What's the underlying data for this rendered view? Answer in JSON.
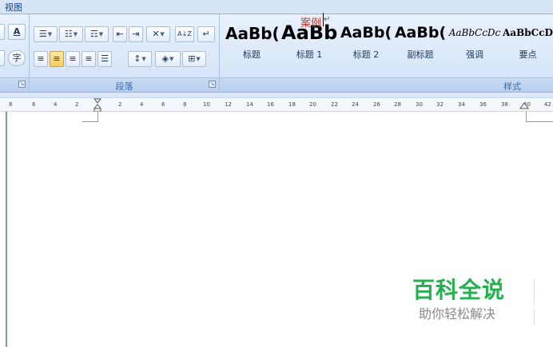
{
  "tabs": {
    "view": "视图"
  },
  "font_group": {
    "font_color_button": "A",
    "phonetic_button": "字"
  },
  "paragraph_group": {
    "label": "段落",
    "bullets": "☰",
    "numbering": "☷",
    "multilevel": "☶",
    "decrease_indent": "⇤",
    "increase_indent": "⇥",
    "chinese_layout": "✕",
    "sort": "A↓Z",
    "show_marks": "↵",
    "align_left": "≡",
    "align_center": "≡",
    "align_right": "≡",
    "justify": "≡",
    "distributed": "☰",
    "line_spacing": "↕",
    "shading": "◈",
    "borders": "⊞"
  },
  "styles_group": {
    "label": "样式",
    "items": [
      {
        "sample": "AaBb(",
        "name": "标题"
      },
      {
        "sample": "AaBb",
        "name": "标题 1"
      },
      {
        "sample": "AaBb(",
        "name": "标题 2"
      },
      {
        "sample": "AaBb(",
        "name": "副标题"
      },
      {
        "sample": "AaBbCcDc",
        "name": "强调"
      },
      {
        "sample": "AaBbCcD",
        "name": "要点"
      }
    ]
  },
  "ruler": {
    "ticks": [
      "8",
      "6",
      "4",
      "2",
      "2",
      "4",
      "6",
      "8",
      "10",
      "12",
      "14",
      "16",
      "18",
      "20",
      "22",
      "24",
      "26",
      "28",
      "30",
      "32",
      "34",
      "36",
      "38",
      "40",
      "42"
    ]
  },
  "document": {
    "text": "案例",
    "paragraph_mark": "↵"
  },
  "watermark": {
    "title": "百科全说",
    "subtitle": "助你轻松解决"
  },
  "colors": {
    "ribbon_bg": "#dbe8f9",
    "accent_active": "#f8cc5c",
    "doc_text": "#c0392b",
    "watermark_green": "#22b14c"
  }
}
